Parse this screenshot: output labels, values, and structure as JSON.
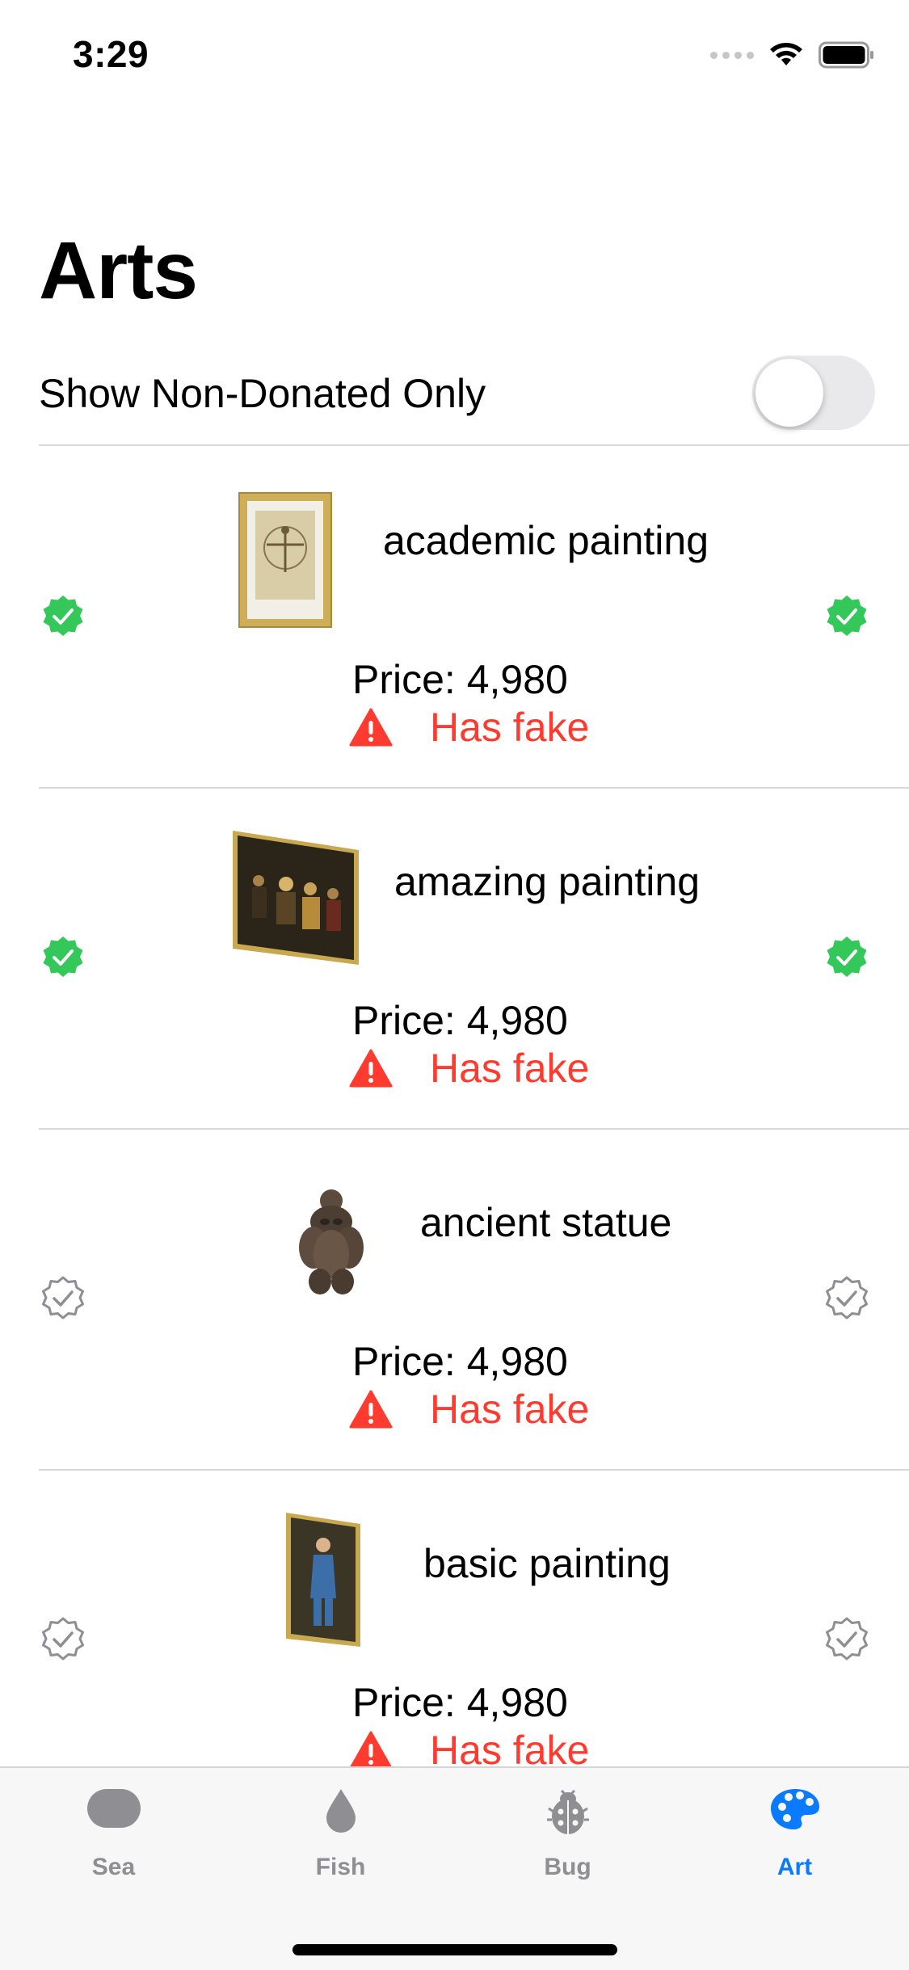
{
  "status": {
    "time": "3:29"
  },
  "page": {
    "title": "Arts"
  },
  "filter": {
    "label": "Show Non-Donated Only",
    "enabled": false
  },
  "items": [
    {
      "name": "academic painting",
      "price": "Price: 4,980",
      "fake": "Has fake",
      "donated": true,
      "caught": true
    },
    {
      "name": "amazing painting",
      "price": "Price: 4,980",
      "fake": "Has fake",
      "donated": true,
      "caught": true
    },
    {
      "name": "ancient statue",
      "price": "Price: 4,980",
      "fake": "Has fake",
      "donated": false,
      "caught": false
    },
    {
      "name": "basic painting",
      "price": "Price: 4,980",
      "fake": "Has fake",
      "donated": false,
      "caught": false
    }
  ],
  "tabs": [
    {
      "label": "Sea",
      "icon": "sea-icon",
      "active": false
    },
    {
      "label": "Fish",
      "icon": "drop-icon",
      "active": false
    },
    {
      "label": "Bug",
      "icon": "ladybug-icon",
      "active": false
    },
    {
      "label": "Art",
      "icon": "palette-icon",
      "active": true
    }
  ],
  "colors": {
    "accent": "#0a7aff",
    "success": "#34c759",
    "warning": "#ff3b30",
    "inactive": "#8e8e93"
  }
}
